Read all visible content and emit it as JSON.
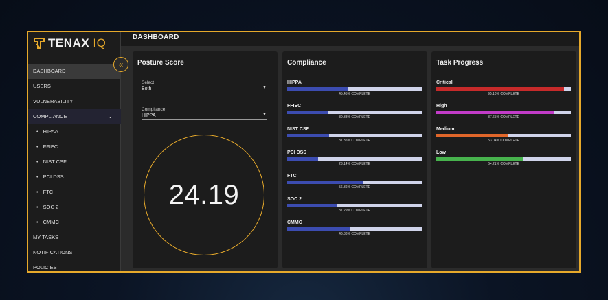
{
  "brand": {
    "name": "TENAX",
    "suffix": "IQ",
    "accent": "#e6a92b"
  },
  "header": {
    "title": "DASHBOARD"
  },
  "sidebar": {
    "items": [
      {
        "label": "DASHBOARD"
      },
      {
        "label": "USERS"
      },
      {
        "label": "VULNERABILITY"
      },
      {
        "label": "COMPLIANCE"
      },
      {
        "label": "HIPAA"
      },
      {
        "label": "FFIEC"
      },
      {
        "label": "NIST CSF"
      },
      {
        "label": "PCI DSS"
      },
      {
        "label": "FTC"
      },
      {
        "label": "SOC 2"
      },
      {
        "label": "CMMC"
      },
      {
        "label": "MY TASKS"
      },
      {
        "label": "NOTIFICATIONS"
      },
      {
        "label": "POLICIES"
      }
    ],
    "collapse_icon": "double-chevron-left-icon",
    "expand_icon": "chevron-down-icon"
  },
  "posture": {
    "title": "Posture Score",
    "select": {
      "label": "Select",
      "value": "Both"
    },
    "compliance": {
      "label": "Compliance",
      "value": "HIPPA"
    },
    "score": "24.19"
  },
  "compliance": {
    "title": "Compliance",
    "fill_color": "#3c4cb0",
    "track_color": "#cfd3ea",
    "items": [
      {
        "label": "HIPPA",
        "pct_text": "45.45% COMPLETE",
        "value": 45.45
      },
      {
        "label": "FFIEC",
        "pct_text": "30.38% COMPLETE",
        "value": 30.38
      },
      {
        "label": "NIST CSF",
        "pct_text": "31.35% COMPLETE",
        "value": 31.35
      },
      {
        "label": "PCI DSS",
        "pct_text": "23.14% COMPLETE",
        "value": 23.14
      },
      {
        "label": "FTC",
        "pct_text": "56.36% COMPLETE",
        "value": 56.36
      },
      {
        "label": "SOC 2",
        "pct_text": "37.29% COMPLETE",
        "value": 37.29
      },
      {
        "label": "CMMC",
        "pct_text": "46.36% COMPLETE",
        "value": 46.36
      }
    ]
  },
  "tasks": {
    "title": "Task Progress",
    "items": [
      {
        "label": "Critical",
        "pct_text": "95.10% COMPLETE",
        "value": 95.1,
        "color": "#c62a2a"
      },
      {
        "label": "High",
        "pct_text": "87.65% COMPLETE",
        "value": 87.65,
        "color": "#c23cc8"
      },
      {
        "label": "Medium",
        "pct_text": "53.04% COMPLETE",
        "value": 53.04,
        "color": "#e0662a"
      },
      {
        "label": "Low",
        "pct_text": "64.21% COMPLETE",
        "value": 64.21,
        "color": "#47b34d"
      }
    ]
  }
}
